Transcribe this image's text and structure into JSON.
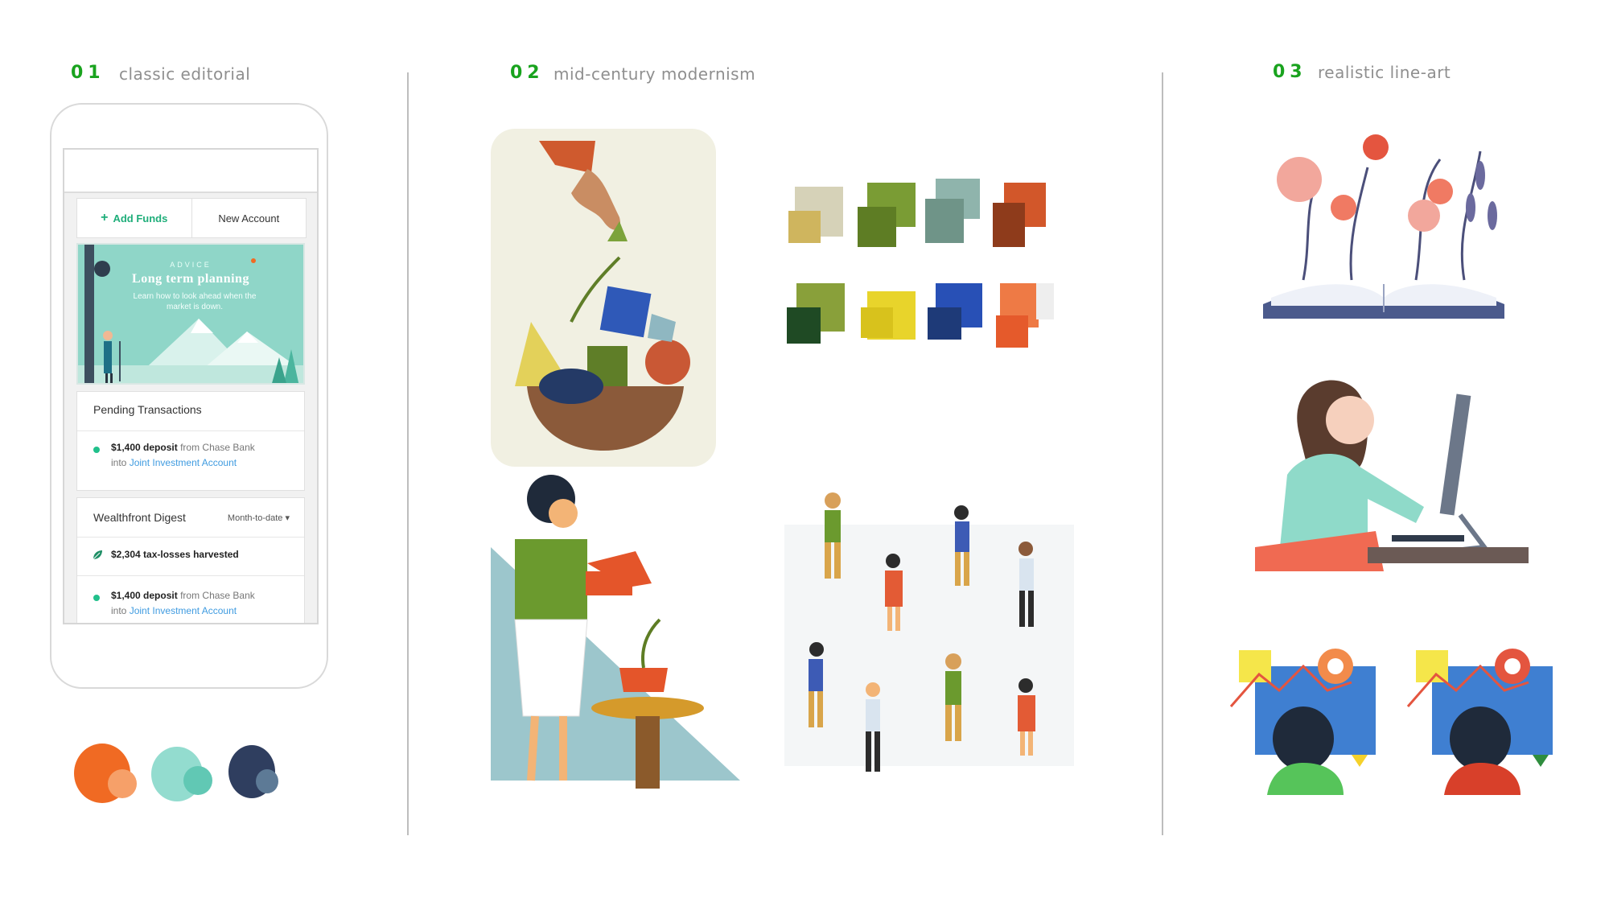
{
  "sections": [
    {
      "number": "01",
      "title": "classic editorial"
    },
    {
      "number": "02",
      "title": "mid-century modernism"
    },
    {
      "number": "03",
      "title": "realistic line-art"
    }
  ],
  "phone": {
    "buttons": {
      "add_funds": "Add Funds",
      "new_account": "New Account"
    },
    "advice": {
      "kicker": "ADVICE",
      "title": "Long term planning",
      "subtitle": "Learn how to look ahead when the market is down."
    },
    "pending": {
      "title": "Pending Transactions",
      "item": {
        "amount": "$1,400 deposit",
        "from": "from Chase Bank",
        "into": "into",
        "account": "Joint Investment Account"
      }
    },
    "digest": {
      "title": "Wealthfront Digest",
      "filter": "Month-to-date",
      "harvest": "$2,304 tax-losses harvested",
      "item": {
        "amount": "$1,400 deposit",
        "from": "from Chase Bank",
        "into": "into",
        "account": "Joint Investment Account"
      }
    }
  },
  "colors": {
    "accent_green": "#19a31e",
    "brand_teal": "#1fae7a",
    "swatch_pairs": [
      [
        "#f06a23",
        "#f6a069"
      ],
      [
        "#93dccf",
        "#61c8b4"
      ],
      [
        "#2f3e5f",
        "#5d7a96"
      ]
    ],
    "palette": [
      "#d6d2b8",
      "#5e7d24",
      "#6f9488",
      "#c24e26",
      "#6f7f20",
      "#e8d42b",
      "#2850b6",
      "#ee7a45"
    ]
  },
  "icons": [
    "plus-icon",
    "leaf-icon",
    "chevron-down-icon"
  ]
}
